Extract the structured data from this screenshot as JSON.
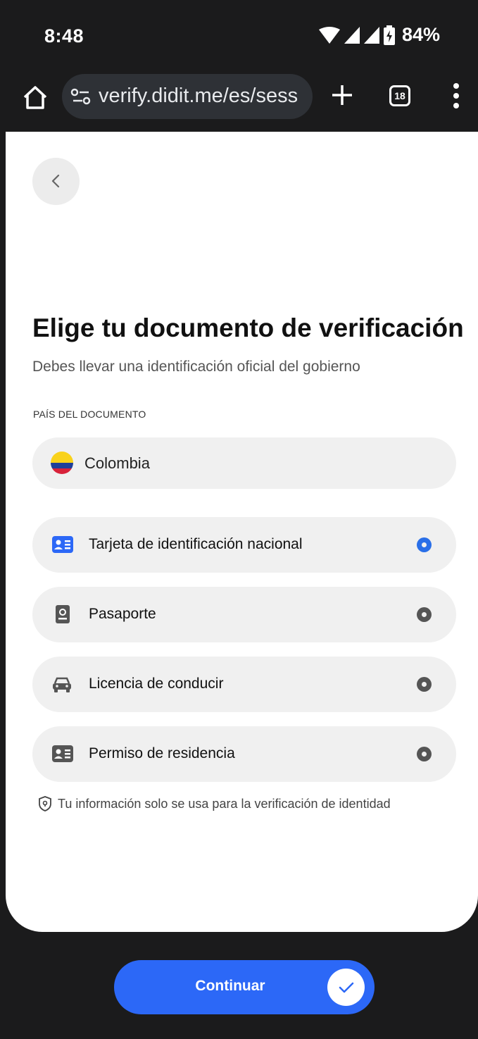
{
  "status": {
    "time": "8:48",
    "battery": "84%"
  },
  "browser": {
    "url": "verify.didit.me/es/sess",
    "tab_count": "18"
  },
  "page": {
    "title": "Elige tu documento de verificación",
    "subtitle": "Debes llevar una identificación oficial del gobierno",
    "country_section_label": "PAÍS DEL DOCUMENTO",
    "country": {
      "name": "Colombia",
      "flag_colors": [
        "#f9d21b",
        "#1e3f99",
        "#d8223a"
      ]
    },
    "documents": [
      {
        "label": "Tarjeta de identificación nacional",
        "icon": "id-card-icon",
        "selected": true
      },
      {
        "label": "Pasaporte",
        "icon": "passport-icon",
        "selected": false
      },
      {
        "label": "Licencia de conducir",
        "icon": "car-icon",
        "selected": false
      },
      {
        "label": "Permiso de residencia",
        "icon": "residence-card-icon",
        "selected": false
      }
    ],
    "privacy_note": "Tu información solo se usa para la verificación de identidad",
    "continue_label": "Continuar"
  },
  "colors": {
    "accent": "#2c68f7",
    "selected_radio": "#2a6fe8",
    "unselected_radio": "#555555"
  }
}
